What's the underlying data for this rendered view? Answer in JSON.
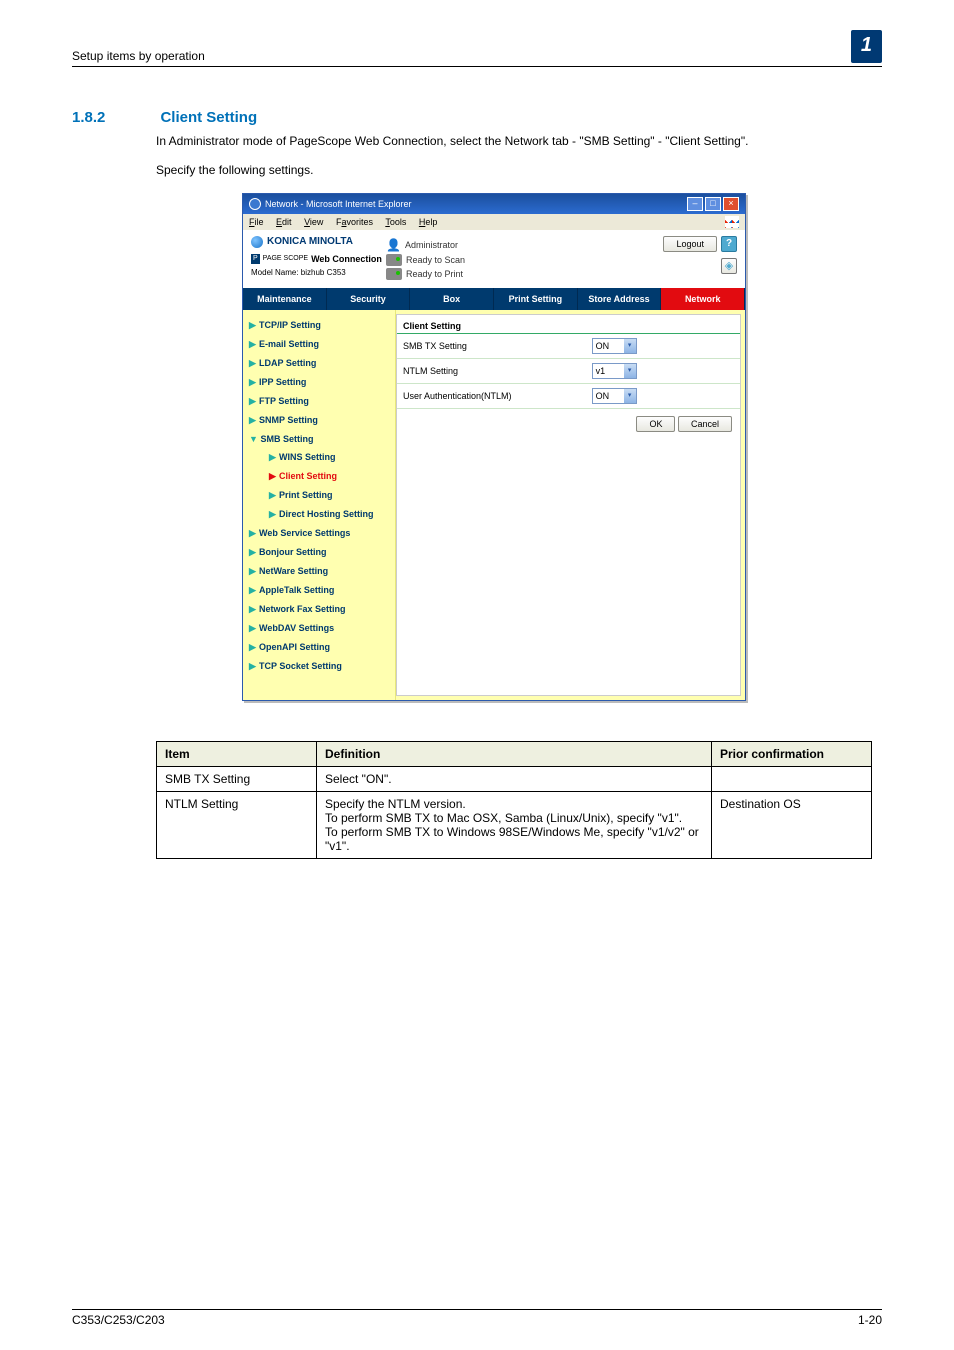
{
  "page": {
    "header": "Setup items by operation",
    "chapter": "1",
    "section_number": "1.8.2",
    "section_title": "Client Setting",
    "para1": "In Administrator mode of PageScope Web Connection, select the Network tab - \"SMB Setting\" - \"Client Setting\".",
    "para2": "Specify the following settings."
  },
  "screenshot": {
    "window_title": "Network - Microsoft Internet Explorer",
    "menus": {
      "file": "File",
      "edit": "Edit",
      "view": "View",
      "favorites": "Favorites",
      "tools": "Tools",
      "help": "Help"
    },
    "brand": "KONICA MINOLTA",
    "subbrand_pre": "PAGE SCOPE",
    "subbrand": "Web Connection",
    "model": "Model Name: bizhub C353",
    "user_role": "Administrator",
    "status1": "Ready to Scan",
    "status2": "Ready to Print",
    "logout": "Logout",
    "tabs": {
      "t1": "Maintenance",
      "t2": "Security",
      "t3": "Box",
      "t4": "Print Setting",
      "t5": "Store Address",
      "t6": "Network"
    },
    "nav": {
      "tcpip": "TCP/IP Setting",
      "email": "E-mail Setting",
      "ldap": "LDAP Setting",
      "ipp": "IPP Setting",
      "ftp": "FTP Setting",
      "snmp": "SNMP Setting",
      "smb": "SMB Setting",
      "wins": "WINS Setting",
      "client": "Client Setting",
      "print": "Print Setting",
      "dhost": "Direct Hosting Setting",
      "ws": "Web Service Settings",
      "bonjour": "Bonjour Setting",
      "netware": "NetWare Setting",
      "appletalk": "AppleTalk Setting",
      "fax": "Network Fax Setting",
      "webdav": "WebDAV Settings",
      "openapi": "OpenAPI Setting",
      "tcpsocket": "TCP Socket Setting"
    },
    "pane": {
      "title": "Client Setting",
      "rows": [
        {
          "label": "SMB TX Setting",
          "value": "ON"
        },
        {
          "label": "NTLM Setting",
          "value": "v1"
        },
        {
          "label": "User Authentication(NTLM)",
          "value": "ON"
        }
      ],
      "ok": "OK",
      "cancel": "Cancel"
    }
  },
  "table": {
    "headers": {
      "c1": "Item",
      "c2": "Definition",
      "c3": "Prior confirmation"
    },
    "rows": [
      {
        "item": "SMB TX Setting",
        "def": "Select \"ON\".",
        "prior": ""
      },
      {
        "item": "NTLM Setting",
        "def": "Specify the NTLM version.\nTo perform SMB TX to Mac OSX, Samba (Linux/Unix), specify \"v1\".\nTo perform SMB TX to Windows 98SE/Windows Me, specify \"v1/v2\" or \"v1\".",
        "prior": "Destination OS"
      }
    ]
  },
  "footer": {
    "left": "C353/C253/C203",
    "right": "1-20"
  }
}
